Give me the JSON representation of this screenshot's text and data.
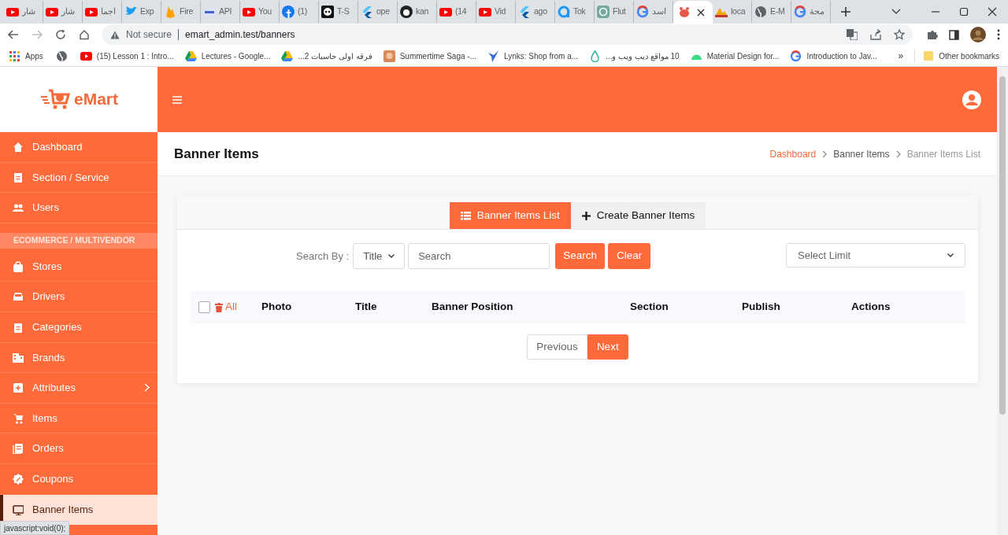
{
  "browser": {
    "tabs": [
      {
        "title": "شار",
        "selected": false
      },
      {
        "title": "شار",
        "selected": false
      },
      {
        "title": "اجما",
        "selected": false
      },
      {
        "title": "Exp",
        "selected": false
      },
      {
        "title": "Fire",
        "selected": false
      },
      {
        "title": "API",
        "selected": false
      },
      {
        "title": "You",
        "selected": false
      },
      {
        "title": "(1)",
        "selected": false
      },
      {
        "title": "T-S",
        "selected": false
      },
      {
        "title": "ope",
        "selected": false
      },
      {
        "title": "kan",
        "selected": false
      },
      {
        "title": "(14",
        "selected": false
      },
      {
        "title": "Vid",
        "selected": false
      },
      {
        "title": "ago",
        "selected": false
      },
      {
        "title": "Tok",
        "selected": false
      },
      {
        "title": "Flut",
        "selected": false
      },
      {
        "title": "اسد",
        "selected": false
      },
      {
        "selected": true
      },
      {
        "title": "loca",
        "selected": false
      },
      {
        "title": "E-M",
        "selected": false
      },
      {
        "title": "محة",
        "selected": false
      }
    ],
    "security": "Not secure",
    "url": "emart_admin.test/banners",
    "bookmarks": [
      {
        "kind": "link",
        "title": "Apps"
      },
      {
        "kind": "icon_only"
      },
      {
        "kind": "link",
        "title": "(15) Lesson 1 : Intro..."
      },
      {
        "kind": "link",
        "title": "Lectures - Google..."
      },
      {
        "kind": "link",
        "title": "فرقه اولى حاسبات 2..."
      },
      {
        "kind": "link",
        "title": "Summertime Saga -..."
      },
      {
        "kind": "link",
        "title": "Lynks: Shop from a..."
      },
      {
        "kind": "link",
        "title": "10 مواقع ديب ويب و..."
      },
      {
        "kind": "link",
        "title": "Material Design for..."
      },
      {
        "kind": "link",
        "title": "Introduction to Jav..."
      }
    ],
    "more_bookmarks": "»",
    "other_bookmarks": "Other bookmarks",
    "status_url": "javascript:void(0);"
  },
  "logo": "eMart",
  "sidebar": {
    "items": [
      {
        "kind": "link",
        "label": "Dashboard",
        "selected": false
      },
      {
        "kind": "link",
        "label": "Section / Service",
        "selected": false
      },
      {
        "kind": "link",
        "label": "Users",
        "selected": false
      },
      {
        "kind": "header",
        "label": "ECOMMERCE / MULTIVENDOR"
      },
      {
        "kind": "link",
        "label": "Stores",
        "selected": false
      },
      {
        "kind": "link",
        "label": "Drivers",
        "selected": false
      },
      {
        "kind": "link",
        "label": "Categories",
        "selected": false
      },
      {
        "kind": "link",
        "label": "Brands",
        "selected": false
      },
      {
        "kind": "submenu",
        "label": "Attributes",
        "selected": false
      },
      {
        "kind": "link",
        "label": "Items",
        "selected": false
      },
      {
        "kind": "link",
        "label": "Orders",
        "selected": false
      },
      {
        "kind": "link",
        "label": "Coupons",
        "selected": false
      },
      {
        "kind": "link",
        "label": "Banner Items",
        "selected": true
      }
    ]
  },
  "page_title": "Banner Items",
  "breadcrumbs": [
    {
      "kind": "link",
      "label": "Dashboard"
    },
    {
      "kind": "parent",
      "label": "Banner Items"
    },
    {
      "kind": "current",
      "label": "Banner Items List"
    }
  ],
  "tabs": [
    {
      "label": "Banner Items List",
      "selected": true
    },
    {
      "label": "Create Banner Items",
      "selected": false
    }
  ],
  "search": {
    "label": "Search By :",
    "field_select": "Title",
    "placeholder": "Search",
    "search_button": "Search",
    "clear_button": "Clear",
    "limit_placeholder": "Select Limit"
  },
  "table": {
    "select_all": {
      "checked": false,
      "label": "All"
    },
    "columns": [
      "Photo",
      "Title",
      "Banner Position",
      "Section",
      "Publish",
      "Actions"
    ]
  },
  "pagination": [
    {
      "label": "Previous",
      "selected": false
    },
    {
      "label": "Next",
      "selected": true
    }
  ]
}
